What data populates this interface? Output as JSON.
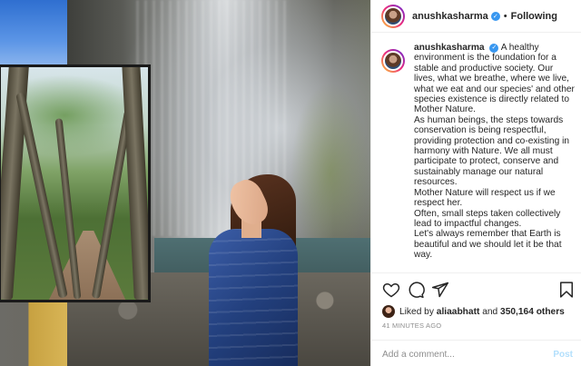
{
  "post": {
    "username": "anushkasharma",
    "separator": "•",
    "follow_label": "Following",
    "caption_lines": [
      "A healthy environment is the foundation for a stable and productive society. Our lives, what we breathe, where we live, what we eat and our species' and other species existence is directly related to Mother Nature.",
      "As human beings, the steps towards conservation is being respectful, providing protection and co-existing in harmony with Nature. We all must participate to protect, conserve and sustainably manage our natural resources.",
      "Mother Nature will respect us if we respect her.",
      "Often, small steps taken collectively lead to impactful changes.",
      "Let's always remember that Earth is beautiful and we should let it be that way."
    ],
    "liked_prefix": "Liked by",
    "liked_user": "aliaabhatt",
    "liked_joiner": "and",
    "liked_others": "350,164 others",
    "timestamp": "41 MINUTES AGO",
    "comment_placeholder": "Add a comment...",
    "post_button": "Post"
  },
  "icons": [
    "heart-icon",
    "comment-icon",
    "share-icon",
    "bookmark-icon",
    "verified-icon"
  ],
  "colors": {
    "verified": "#3897f0",
    "post_disabled": "#b2dffc",
    "muted": "#8e8e8e"
  }
}
